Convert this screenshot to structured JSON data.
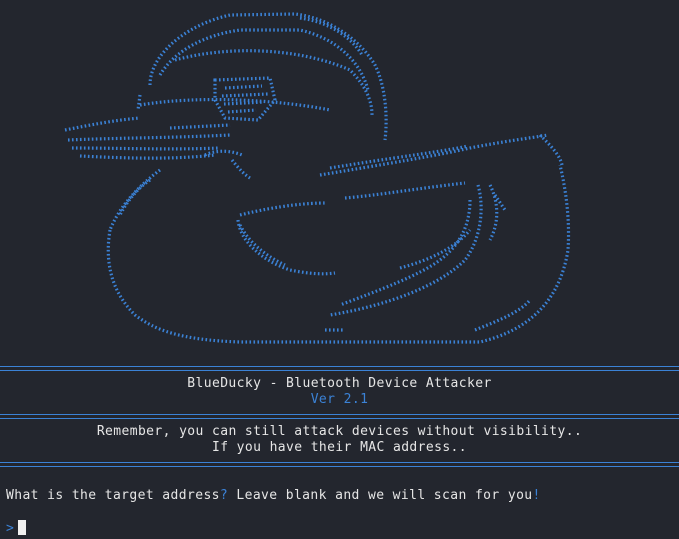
{
  "colors": {
    "background": "#23262e",
    "accent": "#3b82d6",
    "text": "#e6e6e6"
  },
  "banner": {
    "title": "BlueDucky - Bluetooth Device Attacker",
    "version": "Ver 2.1"
  },
  "notice": {
    "line1": "Remember, you can still attack devices without visibility..",
    "line2": "If you have their MAC address.."
  },
  "prompt": {
    "question_part1": "What is the target address",
    "q_mark": "?",
    "question_part2": " Leave blank and we will scan for you",
    "excl": "!",
    "input_marker": ">",
    "input_value": ""
  }
}
